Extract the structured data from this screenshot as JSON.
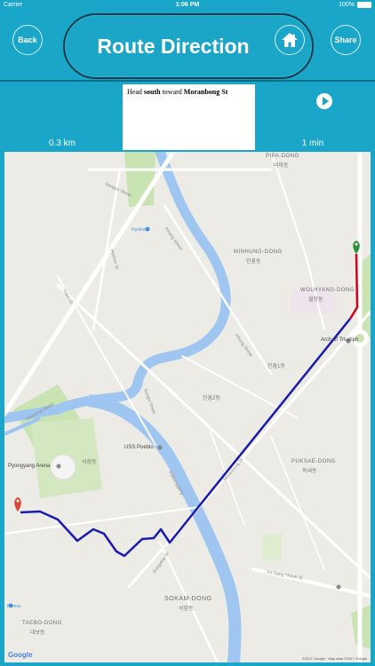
{
  "status_bar": {
    "carrier": "Carrier",
    "time": "1:06 PM",
    "battery": "100%"
  },
  "header": {
    "title": "Route Direction",
    "back_label": "Back",
    "share_label": "Share"
  },
  "route": {
    "instruction_prefix": "Head ",
    "instruction_dir": "south",
    "instruction_mid": " toward ",
    "instruction_street": "Moranbong St",
    "distance": "0.3 km",
    "duration": "1 min"
  },
  "map": {
    "labels": {
      "pipa": "PIPA-DONG",
      "pipa_ko": "비파동",
      "sangon": "Sangon Street",
      "hyokon": "Hyokon",
      "inhung": "Inhung Street",
      "hyokon_st": "Hyokon St",
      "minhung": "MINHUNG-DONG",
      "minhung_ko": "민흥동",
      "wolhyang": "WOLHYANG-DONG",
      "wolhyang_ko": "월향동",
      "arch": "Arch of Triumph",
      "haeri": "Haeri St",
      "inhung1": "인흥1동",
      "inhung2": "인흥2동",
      "inhung_st2": "Inhung Street",
      "moranbong": "Moranbong St",
      "sungni": "Sungni Street",
      "hwasong": "Hwasong Street",
      "uss": "USS Pueblo",
      "arena": "Pyongyang Arena",
      "sojang": "서장동",
      "puksae": "PUKSAE-DONG",
      "puksae_ko": "북새동",
      "pothonggang": "Pothonggang",
      "pongwha": "Pongwha St",
      "ansangtaek": "An Sang Thaek St",
      "sokam": "SOKAM-DONG",
      "sokam_ko": "석암동",
      "taebo": "TAEBO-DONG",
      "taebo_ko": "대보동",
      "kumsusan": "Kumsu"
    },
    "google": "Google",
    "attribution": "©2017 Google · Map data ©2017 Google",
    "colors": {
      "route": "#1a1ab0",
      "route_start": "#d0021b",
      "river": "#9fc6f0",
      "park": "#c9e3b2",
      "road": "#ffffff"
    }
  }
}
